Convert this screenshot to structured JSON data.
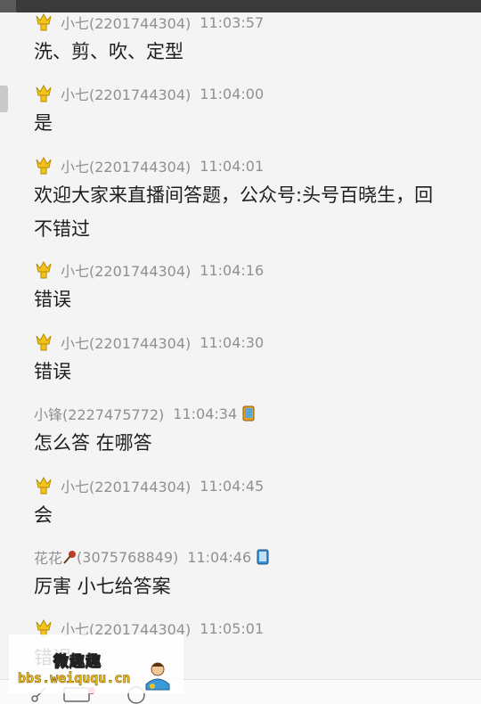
{
  "messages": [
    {
      "sender": "小七(2201744304)",
      "time": "11:03:57",
      "badge": "crown-badge-icon",
      "text": "洗、剪、吹、定型"
    },
    {
      "sender": "小七(2201744304)",
      "time": "11:04:00",
      "badge": "crown-badge-icon",
      "text": "是"
    },
    {
      "sender": "小七(2201744304)",
      "time": "11:04:01",
      "badge": "crown-badge-icon",
      "text": "欢迎大家来直播间答题，公众号:头号百晓生，回",
      "text2": "不错过"
    },
    {
      "sender": "小七(2201744304)",
      "time": "11:04:16",
      "badge": "crown-badge-icon",
      "text": "错误"
    },
    {
      "sender": "小七(2201744304)",
      "time": "11:04:30",
      "badge": "crown-badge-icon",
      "text": "错误"
    },
    {
      "sender": "小锋(2227475772)",
      "time": "11:04:34",
      "device": "phone-icon",
      "text": "怎么答 在哪答"
    },
    {
      "sender": "小七(2201744304)",
      "time": "11:04:45",
      "badge": "crown-badge-icon",
      "text": "会"
    },
    {
      "sender_name": "花花",
      "sender_id": "(3075768849)",
      "time": "11:04:46",
      "device": "phone-icon",
      "text": "厉害 小七给答案"
    },
    {
      "sender": "小七(2201744304)",
      "time": "11:05:01",
      "badge": "crown-badge-icon",
      "text": "错误"
    }
  ],
  "watermark": {
    "title": "微趣趣",
    "url": "bbs.weiququ.cn"
  },
  "colors": {
    "name": "#909090",
    "text": "#1e1e1e",
    "crown": "#f3c31c",
    "background": "#f4f4f4"
  }
}
